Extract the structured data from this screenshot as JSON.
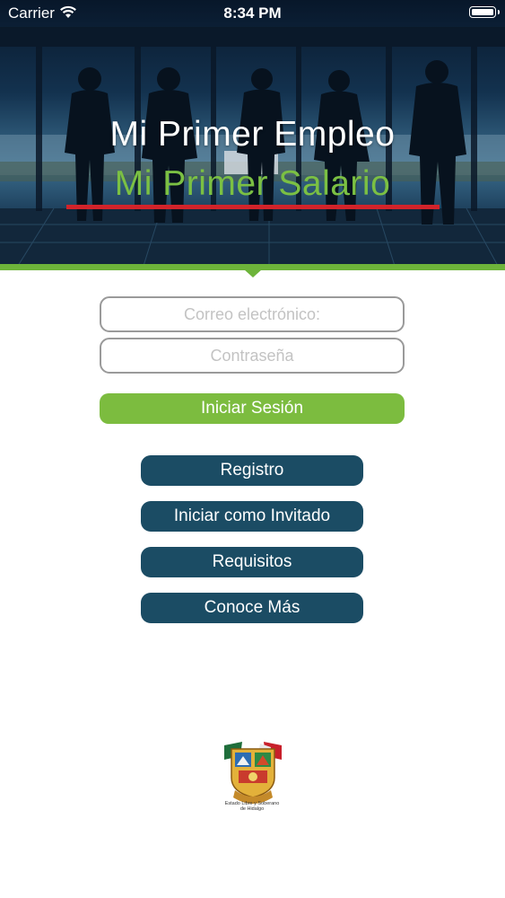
{
  "status_bar": {
    "carrier": "Carrier",
    "time": "8:34 PM",
    "wifi_icon": "wifi-icon",
    "battery_icon": "battery-icon"
  },
  "hero": {
    "title": "Mi Primer Empleo",
    "subtitle": "Mi Primer Salario",
    "subtitle_color": "#7bc043",
    "accent_line_color": "#d2232a",
    "band_color": "#6db43a"
  },
  "login": {
    "email_placeholder": "Correo electrónico:",
    "email_value": "",
    "password_placeholder": "Contraseña",
    "password_value": "",
    "submit_label": "Iniciar Sesión",
    "submit_color": "#7cbc3f"
  },
  "menu": {
    "button_color": "#1b4c64",
    "registro": "Registro",
    "invitado": "Iniciar como Invitado",
    "requisitos": "Requisitos",
    "conoce": "Conoce Más"
  },
  "footer": {
    "crest_caption_line1": "Estado Libre y Soberano",
    "crest_caption_line2": "de Hidalgo"
  }
}
